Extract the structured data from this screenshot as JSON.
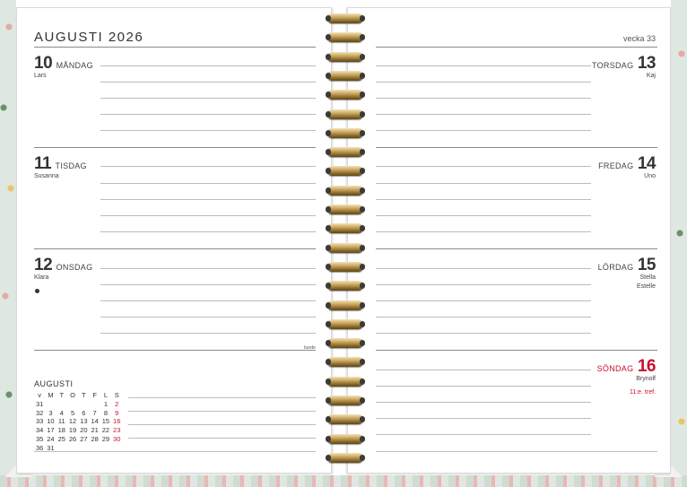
{
  "left_page": {
    "month_title": "AUGUSTI 2026",
    "days": [
      {
        "num": "10",
        "name": "MÅNDAG",
        "nameday": "Lars"
      },
      {
        "num": "11",
        "name": "TISDAG",
        "nameday": "Susanna"
      },
      {
        "num": "12",
        "name": "ONSDAG",
        "nameday": "Klara"
      }
    ],
    "small_note": "burde",
    "mini_calendar": {
      "title": "AUGUSTI",
      "headers": [
        "v",
        "M",
        "T",
        "O",
        "T",
        "F",
        "L",
        "S"
      ],
      "rows": [
        [
          "31",
          "",
          "",
          "",
          "",
          "",
          "1",
          "2"
        ],
        [
          "32",
          "3",
          "4",
          "5",
          "6",
          "7",
          "8",
          "9"
        ],
        [
          "33",
          "10",
          "11",
          "12",
          "13",
          "14",
          "15",
          "16"
        ],
        [
          "34",
          "17",
          "18",
          "19",
          "20",
          "21",
          "22",
          "23"
        ],
        [
          "35",
          "24",
          "25",
          "26",
          "27",
          "28",
          "29",
          "30"
        ],
        [
          "36",
          "31",
          "",
          "",
          "",
          "",
          "",
          ""
        ]
      ]
    }
  },
  "right_page": {
    "week_label": "vecka 33",
    "days": [
      {
        "num": "13",
        "name": "TORSDAG",
        "nameday": "Kaj"
      },
      {
        "num": "14",
        "name": "FREDAG",
        "nameday": "Uno"
      },
      {
        "num": "15",
        "name": "LÖRDAG",
        "nameday": "Stella",
        "nameday2": "Estelle"
      },
      {
        "num": "16",
        "name": "SÖNDAG",
        "nameday": "Brynolf",
        "note": "11:e. tref."
      }
    ]
  },
  "colors": {
    "sunday_red": "#c8102e",
    "ring_gold": "#c9a65f"
  }
}
